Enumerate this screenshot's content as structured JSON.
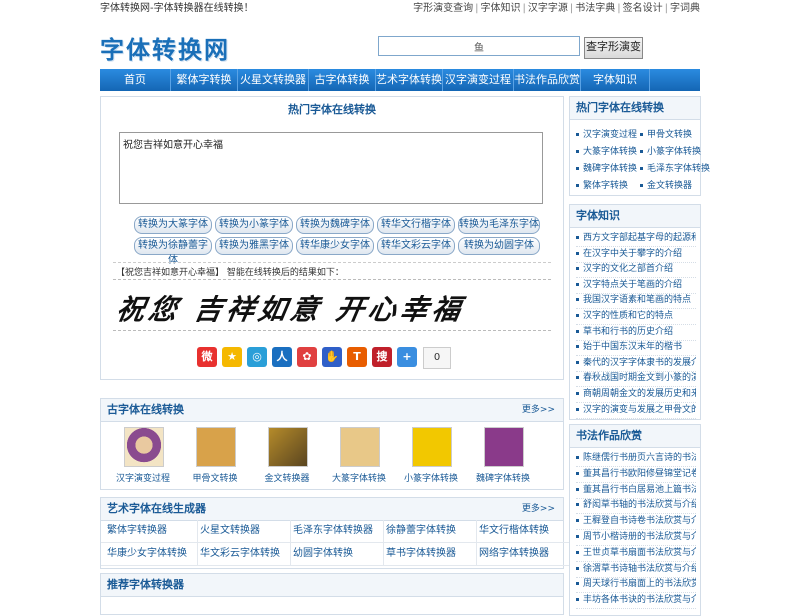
{
  "topbar": {
    "left": "字体转换网-字体转换器在线转换！",
    "links": [
      "字形演变查询",
      "字体知识",
      "汉字字源",
      "书法字典",
      "签名设计",
      "字词典"
    ]
  },
  "header": {
    "logo": "字体转换网",
    "search_value": "鱼",
    "search_button": "查字形演变"
  },
  "nav": [
    "首页",
    "繁体字转换",
    "火星文转换器",
    "古字体转换",
    "艺术字体转换",
    "汉字演变过程",
    "书法作品欣赏",
    "字体知识"
  ],
  "converter": {
    "title": "热门字体在线转换",
    "input_text": "祝您吉祥如意开心幸福",
    "buttons": [
      "转换为大篆字体",
      "转换为小篆字体",
      "转换为魏碑字体",
      "转华文行楷字体",
      "转换为毛泽东字体",
      "转换为徐静蕾字体",
      "转换为雅黑字体",
      "转华康少女字体",
      "转华文彩云字体",
      "转换为幼圆字体"
    ],
    "result_note": "【祝您吉祥如意开心幸福】 智能在线转换后的结果如下：",
    "result_text": "祝您 吉祥如意 开心幸福",
    "share_count": "0",
    "share_icons": [
      "weibo-icon",
      "qzone-icon",
      "tencent-weibo-icon",
      "renren-icon",
      "kaixin-icon",
      "baidu-icon",
      "tianya-icon",
      "sohu-icon",
      "more-share-icon"
    ],
    "share_colors": [
      "#e8312f",
      "#f5b800",
      "#2a9fd8",
      "#1a6fc0",
      "#e04040",
      "#2f5fc8",
      "#e85d00",
      "#c0202a",
      "#3a8ee0"
    ]
  },
  "ancient": {
    "title": "古字体在线转换",
    "more": "更多>>",
    "items": [
      "汉字演变过程",
      "甲骨文转换",
      "金文转换器",
      "大篆字体转换",
      "小篆字体转换",
      "魏碑字体转换"
    ]
  },
  "art": {
    "title": "艺术字体在线生成器",
    "more": "更多>>",
    "items": [
      "繁体字转换器",
      "火星文转换器",
      "毛泽东字体转换器",
      "徐静蕾字体转换",
      "华文行楷体转换",
      "华康少女字体转换",
      "华文彩云字体转换",
      "幼圆字体转换",
      "草书字体转换器",
      "网络字体转换器"
    ]
  },
  "recommend": {
    "title": "推荐字体转换器"
  },
  "side_hot": {
    "title": "热门字体在线转换",
    "items": [
      "汉字演变过程",
      "甲骨文转换",
      "大篆字体转换",
      "小篆字体转换",
      "魏碑字体转换",
      "毛泽东字体转换",
      "繁体字转换",
      "金文转换器"
    ]
  },
  "side_knowledge": {
    "title": "字体知识",
    "items": [
      "西方文字部起基字母的起源和论述",
      "在汉字中关于攀字的介绍",
      "汉字的文化之部首介绍",
      "汉字特点关于笔画的介绍",
      "我国汉字语素和笔画的特点",
      "汉字的性质和它的特点",
      "草书和行书的历史介绍",
      "始于中国东汉末年的楷书",
      "秦代的汉字字体隶书的发展介绍",
      "春秋战国时期金文到小篆的演变历",
      "商朝周朝金文的发展历史和来源",
      "汉字的演变与发展之甲骨文的历史"
    ]
  },
  "side_calligraphy": {
    "title": "书法作品欣赏",
    "items": [
      "陈继儒行书册页六言诗的书法欣赏",
      "董其昌行书欧阳修昼锦堂记卷欣赏",
      "董其昌行书白居易池上篇书法欣赏",
      "舒闳草书轴的书法欣赏与介绍",
      "王穉登自书诗卷书法欣赏与介绍",
      "周节小楷诗册的书法欣赏与介绍",
      "王世贞草书扇面书法欣赏与介绍",
      "徐渭草书诗轴书法欣赏与介绍",
      "周天球行书扇面上的书法欣赏与介",
      "丰坊各体书诀的书法欣赏与介绍"
    ]
  }
}
